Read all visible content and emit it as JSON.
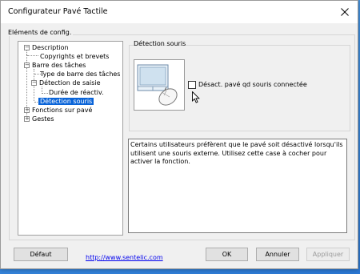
{
  "window": {
    "title": "Configurateur Pavé Tactile"
  },
  "group": {
    "label": "Eléments de config."
  },
  "tree": {
    "description": "Description",
    "copyrights": "Copyrights et brevets",
    "barre": "Barre des tâches",
    "type_barre": "Type de barre des tâches",
    "detection_saisie": "Détection de saisie",
    "duree": "Durée de réactiv.",
    "detection_souris": "Détection souris",
    "fonctions": "Fonctions sur pavé",
    "gestes": "Gestes"
  },
  "panel": {
    "title": "Détection souris",
    "checkbox_label": "Désact. pavé qd souris connectée",
    "checkbox_checked": false,
    "description": "Certains utilisateurs préfèrent que le pavé soit désactivé lorsqu'ils utilisent une souris externe. Utilisez cette case à cocher pour activer la fonction."
  },
  "footer": {
    "default": "Défaut",
    "link": "http://www.sentelic.com",
    "ok": "OK",
    "cancel": "Annuler",
    "apply": "Appliquer"
  }
}
